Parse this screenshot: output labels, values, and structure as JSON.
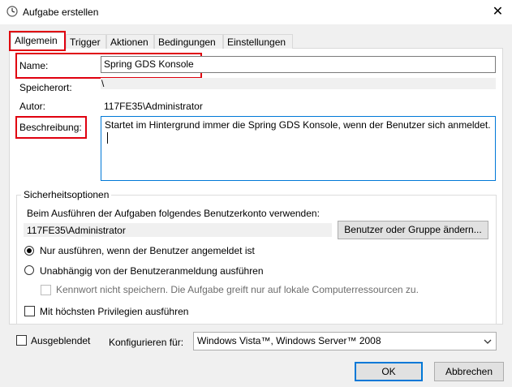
{
  "window": {
    "title": "Aufgabe erstellen",
    "close_glyph": "✕"
  },
  "tabs": [
    {
      "label": "Allgemein"
    },
    {
      "label": "Trigger"
    },
    {
      "label": "Aktionen"
    },
    {
      "label": "Bedingungen"
    },
    {
      "label": "Einstellungen"
    }
  ],
  "general": {
    "name_label": "Name:",
    "name_value": "Spring GDS Konsole",
    "location_label": "Speicherort:",
    "location_value": "\\",
    "author_label": "Autor:",
    "author_value": "117FE35\\Administrator",
    "description_label": "Beschreibung:",
    "description_value": "Startet im Hintergrund immer die Spring GDS Konsole, wenn der Benutzer sich anmeldet."
  },
  "security": {
    "group_label": "Sicherheitsoptionen",
    "account_prompt": "Beim Ausführen der Aufgaben folgendes Benutzerkonto verwenden:",
    "account_value": "117FE35\\Administrator",
    "change_button": "Benutzer oder Gruppe ändern...",
    "radio_logged_on": "Nur ausführen, wenn der Benutzer angemeldet ist",
    "radio_independent": "Unabhängig von der Benutzeranmeldung ausführen",
    "no_password_check": "Kennwort nicht speichern. Die Aufgabe greift nur auf lokale Computerressourcen zu.",
    "highest_privileges": "Mit höchsten Privilegien ausführen"
  },
  "footer": {
    "hidden_label": "Ausgeblendet",
    "configure_label": "Konfigurieren für:",
    "configure_value": "Windows Vista™, Windows Server™ 2008",
    "ok_label": "OK",
    "cancel_label": "Abbrechen"
  },
  "colors": {
    "highlight": "#e0000f",
    "accent": "#0078d7"
  },
  "icons": {
    "title": "clock-icon",
    "dropdown": "chevron-down-icon"
  }
}
